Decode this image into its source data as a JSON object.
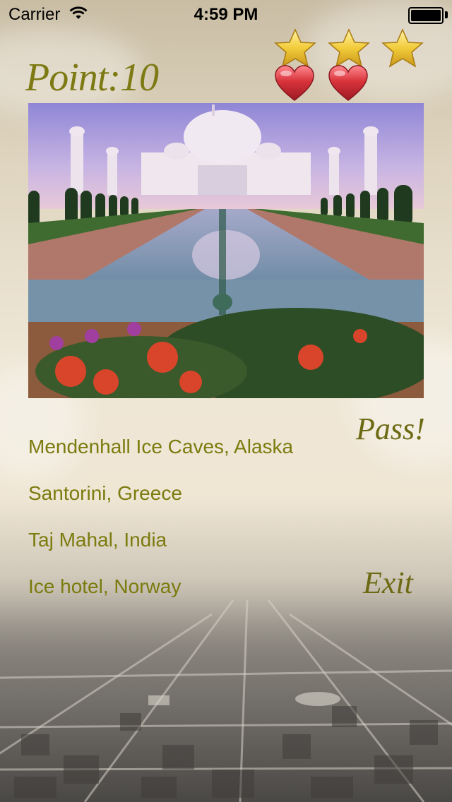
{
  "status_bar": {
    "carrier": "Carrier",
    "time": "4:59 PM"
  },
  "game": {
    "points_label": "Point:10",
    "stars_count": 3,
    "hearts_count": 2
  },
  "photo": {
    "subject": "Taj Mahal"
  },
  "answers": [
    "Mendenhall Ice Caves, Alaska",
    "Santorini, Greece",
    "Taj Mahal, India",
    "Ice hotel, Norway"
  ],
  "actions": {
    "pass_label": "Pass!",
    "exit_label": "Exit"
  },
  "colors": {
    "answer_text": "#7b7b0e",
    "script_text": "#6d6a14",
    "heart": "#d9333b",
    "star": "#f2cc3a"
  }
}
